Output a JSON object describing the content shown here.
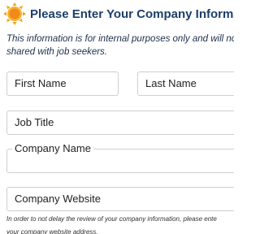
{
  "header": {
    "title": "Please Enter Your Company Information",
    "icon": "sun-badge-icon",
    "icon_color": "#f5a623"
  },
  "intro": {
    "line1": "This information is for internal purposes only and will not b",
    "line2": "shared with job seekers."
  },
  "form": {
    "first_name_placeholder": "First Name",
    "last_name_placeholder": "Last Name",
    "job_title_placeholder": "Job Title",
    "company_name_label": "Company Name",
    "company_website_placeholder": "Company Website"
  },
  "note": {
    "line1": "In order to not delay the review of your company information, please ente",
    "line2": "your company website address."
  },
  "colors": {
    "title": "#1d3e6b",
    "border": "#cfcfcf"
  }
}
